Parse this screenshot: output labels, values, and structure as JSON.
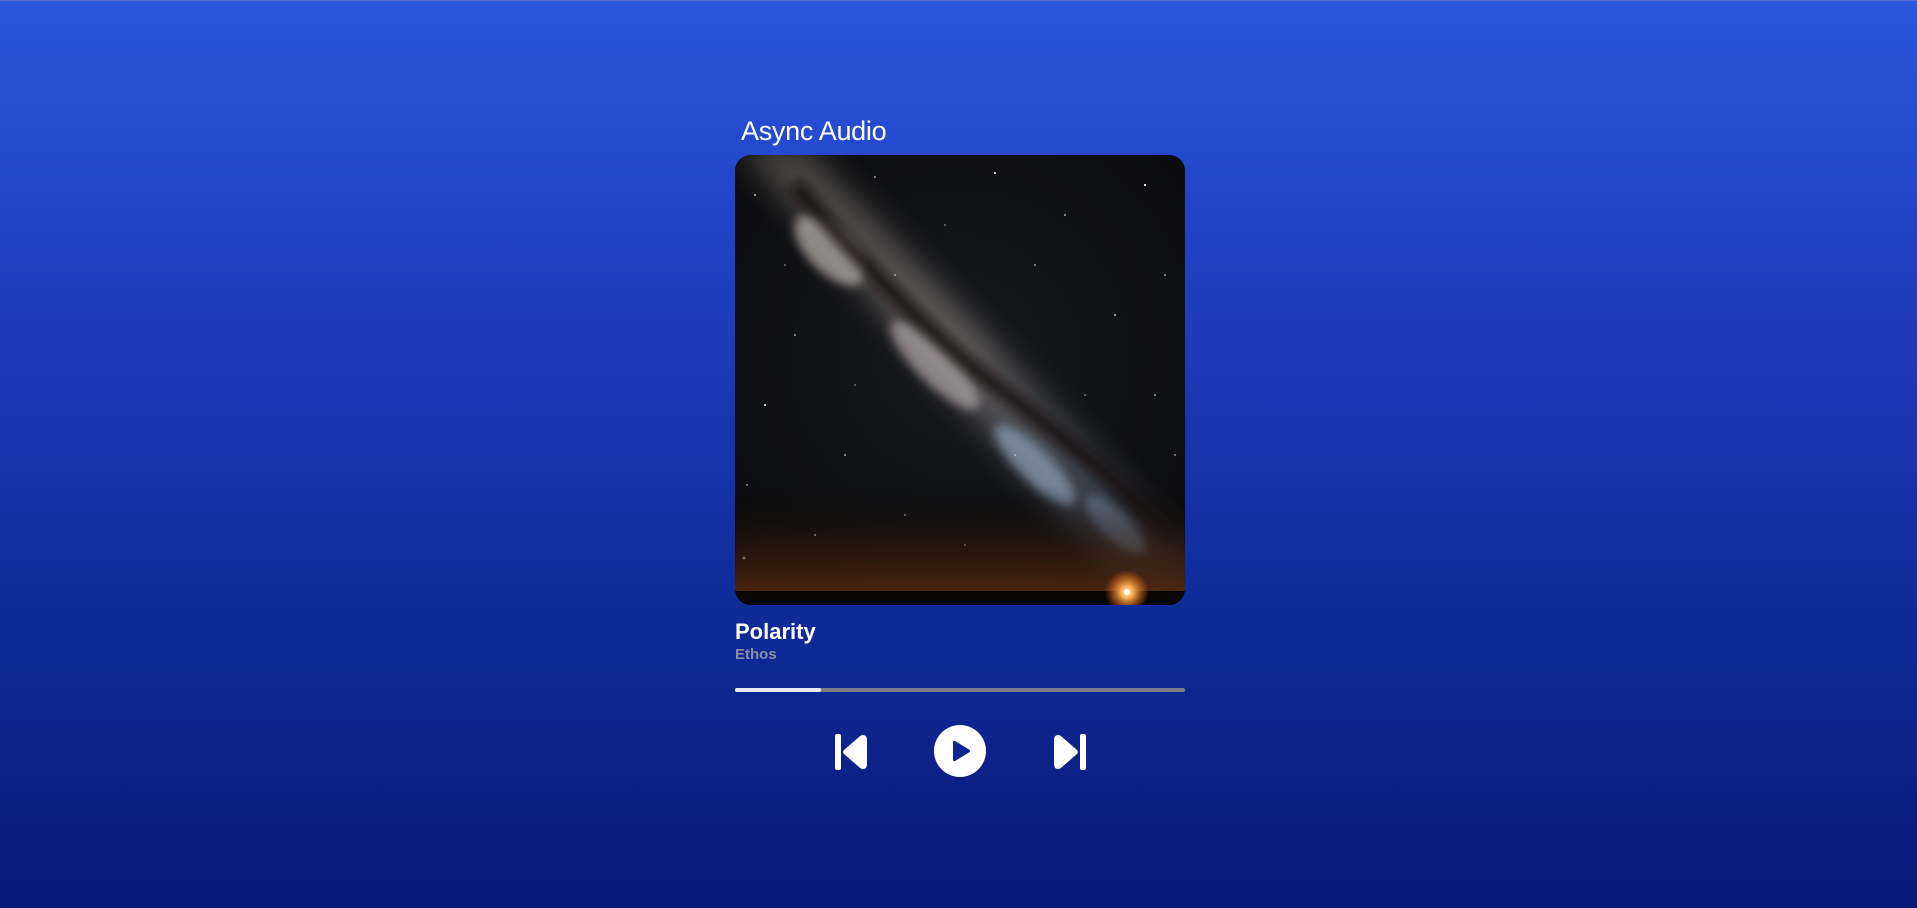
{
  "app": {
    "title": "Async Audio"
  },
  "track": {
    "title": "Polarity",
    "artist": "Ethos",
    "cover_description_icon": "album-cover-image"
  },
  "playback": {
    "progress_fraction": 0.19,
    "state": "paused"
  },
  "controls": {
    "previous_icon": "skip-previous-icon",
    "play_icon": "play-icon",
    "next_icon": "skip-next-icon"
  },
  "colors": {
    "background_top": "#2c55dd",
    "background_bottom": "#08197a",
    "progress_fill": "#e9e9ee",
    "progress_track": "#7d7f8a",
    "artist_text": "#8a8ea3"
  }
}
